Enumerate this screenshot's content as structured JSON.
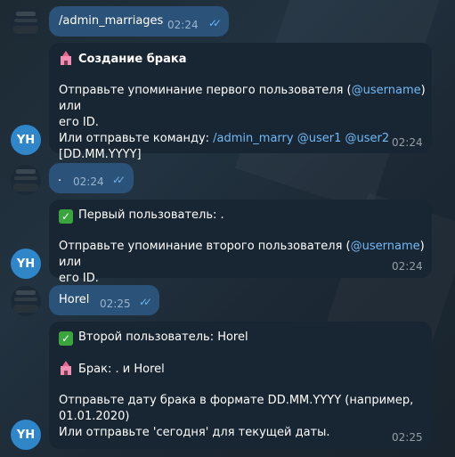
{
  "messages": {
    "m1": {
      "text": "/admin_marriages",
      "time": "02:24"
    },
    "m2": {
      "title": "Создание брака",
      "line1_a": "Отправьте упоминание первого пользователя (",
      "line1_link": "@username",
      "line1_b": ") или",
      "line2": "его ID.",
      "line3_a": "Или отправьте команду: ",
      "line3_cmd": "/admin_marry",
      "line3_u1": "@user1",
      "line3_u2": "@user2",
      "line4": "[DD.MM.YYYY]",
      "time": "02:24"
    },
    "m3": {
      "text": ".",
      "time": "02:24"
    },
    "m4": {
      "line1": "Первый пользователь: .",
      "line2_a": "Отправьте упоминание второго пользователя (",
      "line2_link": "@username",
      "line2_b": ") или",
      "line3": "его ID.",
      "time": "02:24"
    },
    "m5": {
      "text": "Horel",
      "time": "02:25"
    },
    "m6": {
      "line1": "Второй пользователь: Horel",
      "line2": "Брак: . и Horel",
      "line3": "Отправьте дату брака в формате DD.MM.YYYY (например,",
      "line4": "01.01.2020)",
      "line5": "Или отправьте 'сегодня' для текущей даты.",
      "time": "02:25"
    }
  },
  "bot_avatar": {
    "initials": "YH",
    "color": "#2f86c9"
  },
  "colors": {
    "outgoing": "#2b5278",
    "incoming": "#182533",
    "link": "#71baf5",
    "ticks": "#6fb3ef"
  }
}
